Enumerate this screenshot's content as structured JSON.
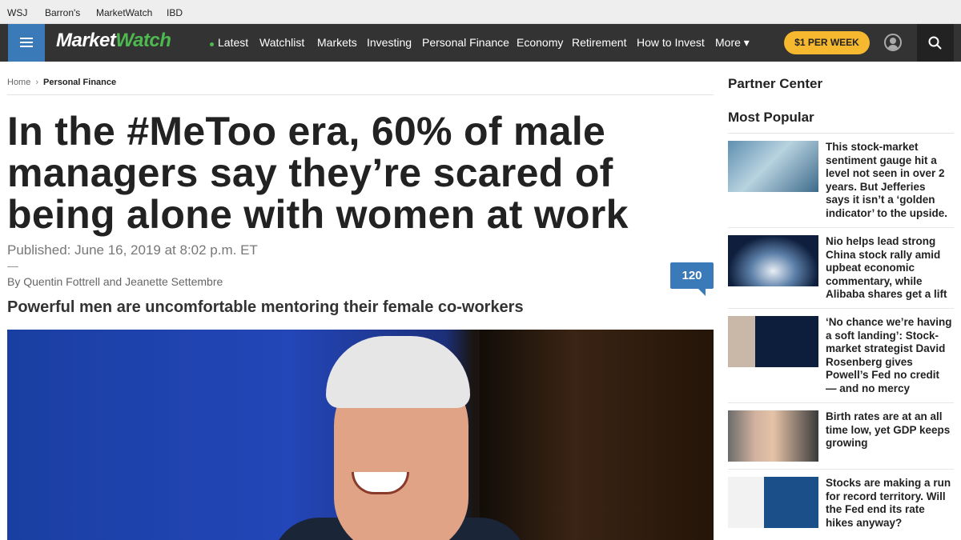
{
  "network_bar": {
    "links": [
      "WSJ",
      "Barron's",
      "MarketWatch",
      "IBD"
    ]
  },
  "nav": {
    "logo_market": "Market",
    "logo_watch": "Watch",
    "items": [
      "Latest",
      "Watchlist",
      "Markets",
      "Investing",
      "Personal Finance",
      "Economy",
      "Retirement",
      "How to Invest",
      "More ▾"
    ],
    "subscribe_label": "$1 PER WEEK",
    "icons": {
      "menu": "hamburger-menu-icon",
      "user": "user-avatar-icon",
      "search": "search-icon"
    }
  },
  "breadcrumb": {
    "home": "Home",
    "separator": "›",
    "current": "Personal Finance"
  },
  "article": {
    "headline": "In the #MeToo era, 60% of male managers say they’re scared of being alone with women at work",
    "published": "Published: June 16, 2019 at 8:02 p.m. ET",
    "byline": "By Quentin Fottrell and Jeanette Settembre",
    "comment_count": "120",
    "subhead": "Powerful men are uncomfortable mentoring their female co-workers"
  },
  "sidebar": {
    "partner_title": "Partner Center",
    "popular_title": "Most Popular",
    "stories": [
      "This stock-market sentiment gauge hit a level not seen in over 2 years. But Jefferies says it isn’t a ‘golden indicator’ to the upside.",
      "Nio helps lead strong China stock rally amid upbeat economic commentary, while Alibaba shares get a lift",
      "‘No chance we’re having a soft landing’: Stock-market strategist David Rosenberg gives Powell’s Fed no credit — and no mercy",
      "Birth rates are at an all time low, yet GDP keeps growing",
      "Stocks are making a run for record territory. Will the Fed end its rate hikes anyway?"
    ]
  },
  "colors": {
    "nav_bg": "#333333",
    "menu_blue": "#3a7ab8",
    "brand_green": "#4eb94f",
    "subscribe_gold": "#f5b82e"
  }
}
